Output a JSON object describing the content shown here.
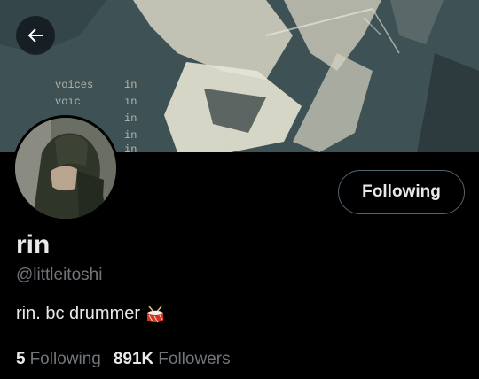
{
  "banner": {
    "text_lines": [
      "voices",
      "voic",
      "in",
      "in",
      "in",
      "in",
      "in"
    ]
  },
  "header": {
    "back_icon": "arrow-left-icon"
  },
  "profile": {
    "follow_label": "Following",
    "display_name": "rin",
    "handle": "@littleitoshi",
    "bio": "rin. bc drummer",
    "bio_emoji": "drum-icon",
    "following_count": "5",
    "following_label": "Following",
    "followers_count": "891K",
    "followers_label": "Followers"
  },
  "colors": {
    "background": "#000000",
    "text_primary": "#e7e9ea",
    "text_secondary": "#71767b",
    "button_border": "#536471"
  }
}
